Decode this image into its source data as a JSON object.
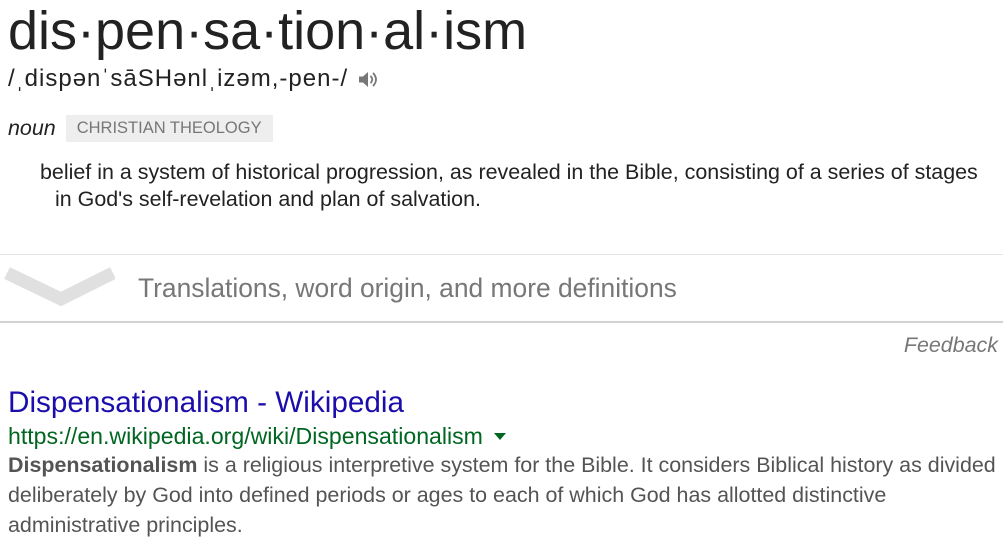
{
  "dictionary": {
    "word": "dis·pen·sa·tion·al·ism",
    "phonetic": "/ˌdispənˈsāSHənlˌizəm,-pen-/",
    "part_of_speech": "noun",
    "subject_label": "CHRISTIAN THEOLOGY",
    "definition": "belief in a system of historical progression, as revealed in the Bible, consisting of a series of stages in God's self-revelation and plan of salvation.",
    "more_label": "Translations, word origin, and more definitions"
  },
  "feedback_label": "Feedback",
  "result": {
    "title": "Dispensationalism - Wikipedia",
    "url": "https://en.wikipedia.org/wiki/Dispensationalism",
    "snippet_bold": "Dispensationalism",
    "snippet_rest": " is a religious interpretive system for the Bible. It considers Biblical history as divided deliberately by God into defined periods or ages to each of which God has allotted distinctive administrative principles."
  },
  "icons": {
    "pronunciation_audio": "speaker-icon",
    "expand_more": "chevron-down-icon",
    "url_menu": "dropdown-arrow-icon"
  },
  "colors": {
    "text": "#222222",
    "muted": "#777777",
    "link": "#1a0dab",
    "url": "#006621",
    "snippet": "#545454",
    "badge_background": "#eeeeee",
    "chevron": "#e0e0e0"
  }
}
